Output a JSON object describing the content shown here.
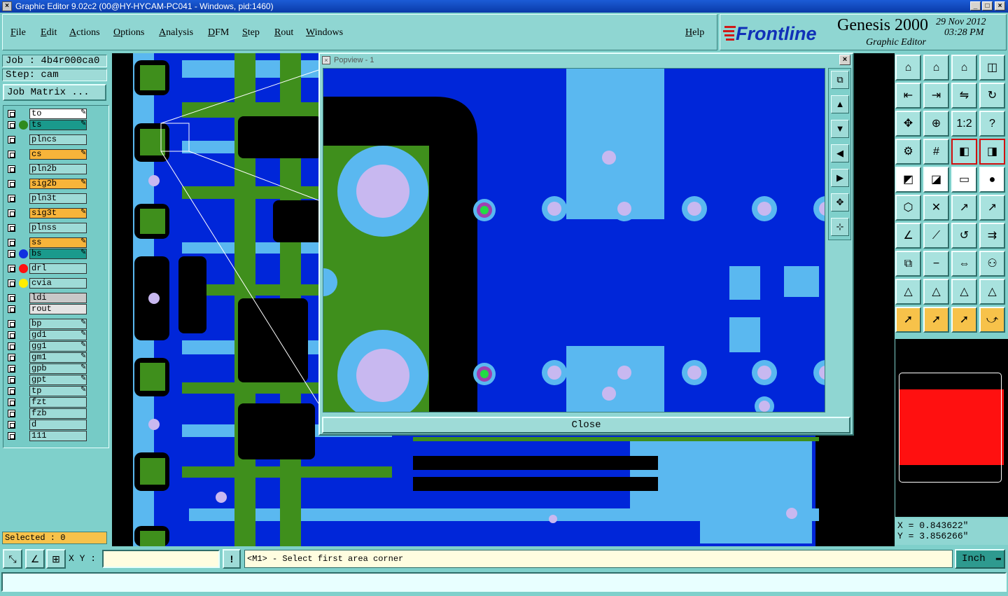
{
  "window": {
    "title": "Graphic Editor 9.02c2 (00@HY-HYCAM-PC041 - Windows, pid:1460)"
  },
  "menu": {
    "items": [
      "File",
      "Edit",
      "Actions",
      "Options",
      "Analysis",
      "DFM",
      "Step",
      "Rout",
      "Windows"
    ],
    "help": "Help"
  },
  "brand": {
    "logo": "Frontline",
    "product": "Genesis 2000",
    "subtitle": "Graphic Editor",
    "date": "29 Nov 2012",
    "time": "03:28 PM"
  },
  "job": {
    "job_label": "Job : 4b4r000ca0",
    "step_label": "Step: cam",
    "matrix_button": "Job Matrix ..."
  },
  "layers": [
    {
      "name": "to",
      "color": "#ffffff",
      "dot": "",
      "pen": true
    },
    {
      "name": "ts",
      "color": "#1a9a8c",
      "dot": "#2f8a1e",
      "pen": true
    },
    {
      "name": "plncs",
      "color": "#9edbd7",
      "dot": "",
      "pen": false
    },
    {
      "name": "cs",
      "color": "#f7b43a",
      "dot": "",
      "pen": true
    },
    {
      "name": "pln2b",
      "color": "#9edbd7",
      "dot": "",
      "pen": false
    },
    {
      "name": "sig2b",
      "color": "#f7b43a",
      "dot": "",
      "pen": true
    },
    {
      "name": "pln3t",
      "color": "#9edbd7",
      "dot": "",
      "pen": false
    },
    {
      "name": "sig3t",
      "color": "#f7b43a",
      "dot": "",
      "pen": true
    },
    {
      "name": "plnss",
      "color": "#9edbd7",
      "dot": "",
      "pen": false
    },
    {
      "name": "ss",
      "color": "#f7b43a",
      "dot": "",
      "pen": true
    },
    {
      "name": "bs",
      "color": "#1a9a8c",
      "dot": "#1030e0",
      "pen": true
    },
    {
      "name": "drl",
      "color": "#9edbd7",
      "dot": "#ff1010",
      "pen": false
    },
    {
      "name": "cvia",
      "color": "#9edbd7",
      "dot": "#ffee00",
      "pen": false
    },
    {
      "name": "ldi",
      "color": "#c8c8c8",
      "dot": "",
      "pen": false
    },
    {
      "name": "rout",
      "color": "#e4e4e4",
      "dot": "",
      "pen": false
    },
    {
      "name": "bp",
      "color": "#9edbd7",
      "dot": "",
      "pen": true
    },
    {
      "name": "gd1",
      "color": "#9edbd7",
      "dot": "",
      "pen": true
    },
    {
      "name": "gg1",
      "color": "#9edbd7",
      "dot": "",
      "pen": true
    },
    {
      "name": "gm1",
      "color": "#9edbd7",
      "dot": "",
      "pen": true
    },
    {
      "name": "gpb",
      "color": "#9edbd7",
      "dot": "",
      "pen": true
    },
    {
      "name": "gpt",
      "color": "#9edbd7",
      "dot": "",
      "pen": true
    },
    {
      "name": "tp",
      "color": "#9edbd7",
      "dot": "",
      "pen": true
    },
    {
      "name": "fzt",
      "color": "#9edbd7",
      "dot": "",
      "pen": false
    },
    {
      "name": "fzb",
      "color": "#9edbd7",
      "dot": "",
      "pen": false
    },
    {
      "name": "d",
      "color": "#9edbd7",
      "dot": "",
      "pen": false
    },
    {
      "name": "111",
      "color": "#9edbd7",
      "dot": "",
      "pen": false
    }
  ],
  "selected": "Selected : 0",
  "popview": {
    "title": "Popview - 1",
    "close_label": "Close"
  },
  "coords": {
    "x": "X = 0.843622\"",
    "y": "Y = 3.856266\""
  },
  "status": {
    "xy_label": "X Y :",
    "xy_value": "",
    "prompt": "<M1> - Select first area corner",
    "unit": "Inch"
  },
  "colors": {
    "board_blue": "#0026d9",
    "plane_cyan": "#5ab8f0",
    "signal_green": "#3f8f1c",
    "pad_lavender": "#c8b8f0",
    "app_teal": "#7fd0cb"
  }
}
